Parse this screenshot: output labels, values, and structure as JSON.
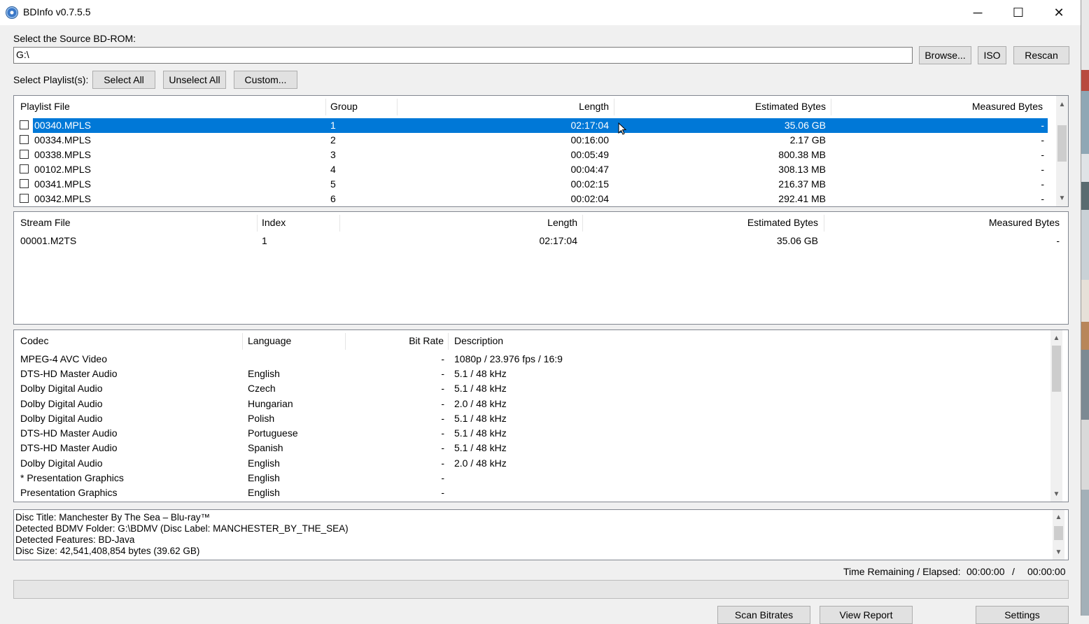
{
  "window": {
    "title": "BDInfo v0.7.5.5",
    "controls": {
      "minimize": "─",
      "maximize": "☐",
      "close": "✕"
    }
  },
  "source": {
    "label": "Select the Source BD-ROM:",
    "path": "G:\\",
    "buttons": {
      "browse": "Browse...",
      "iso": "ISO",
      "rescan": "Rescan"
    }
  },
  "playlist_select": {
    "label": "Select Playlist(s):",
    "buttons": {
      "select_all": "Select All",
      "unselect_all": "Unselect All",
      "custom": "Custom..."
    }
  },
  "playlists": {
    "headers": {
      "file": "Playlist File",
      "group": "Group",
      "length": "Length",
      "estimated": "Estimated Bytes",
      "measured": "Measured Bytes"
    },
    "rows": [
      {
        "file": "00340.MPLS",
        "group": "1",
        "length": "02:17:04",
        "estimated": "35.06 GB",
        "measured": "-",
        "selected": true
      },
      {
        "file": "00334.MPLS",
        "group": "2",
        "length": "00:16:00",
        "estimated": "2.17 GB",
        "measured": "-"
      },
      {
        "file": "00338.MPLS",
        "group": "3",
        "length": "00:05:49",
        "estimated": "800.38 MB",
        "measured": "-"
      },
      {
        "file": "00102.MPLS",
        "group": "4",
        "length": "00:04:47",
        "estimated": "308.13 MB",
        "measured": "-"
      },
      {
        "file": "00341.MPLS",
        "group": "5",
        "length": "00:02:15",
        "estimated": "216.37 MB",
        "measured": "-"
      },
      {
        "file": "00342.MPLS",
        "group": "6",
        "length": "00:02:04",
        "estimated": "292.41 MB",
        "measured": "-"
      }
    ]
  },
  "streams": {
    "headers": {
      "file": "Stream File",
      "index": "Index",
      "length": "Length",
      "estimated": "Estimated Bytes",
      "measured": "Measured Bytes"
    },
    "rows": [
      {
        "file": "00001.M2TS",
        "index": "1",
        "length": "02:17:04",
        "estimated": "35.06 GB",
        "measured": "-"
      }
    ]
  },
  "codecs": {
    "headers": {
      "codec": "Codec",
      "language": "Language",
      "bitrate": "Bit Rate",
      "description": "Description"
    },
    "rows": [
      {
        "codec": "MPEG-4 AVC Video",
        "language": "",
        "bitrate": "-",
        "description": "1080p / 23.976 fps / 16:9"
      },
      {
        "codec": "DTS-HD Master Audio",
        "language": "English",
        "bitrate": "-",
        "description": "5.1 / 48 kHz"
      },
      {
        "codec": "Dolby Digital Audio",
        "language": "Czech",
        "bitrate": "-",
        "description": "5.1 / 48 kHz"
      },
      {
        "codec": "Dolby Digital Audio",
        "language": "Hungarian",
        "bitrate": "-",
        "description": "2.0 / 48 kHz"
      },
      {
        "codec": "Dolby Digital Audio",
        "language": "Polish",
        "bitrate": "-",
        "description": "5.1 / 48 kHz"
      },
      {
        "codec": "DTS-HD Master Audio",
        "language": "Portuguese",
        "bitrate": "-",
        "description": "5.1 / 48 kHz"
      },
      {
        "codec": "DTS-HD Master Audio",
        "language": "Spanish",
        "bitrate": "-",
        "description": "5.1 / 48 kHz"
      },
      {
        "codec": "Dolby Digital Audio",
        "language": "English",
        "bitrate": "-",
        "description": "2.0 / 48 kHz"
      },
      {
        "codec": "* Presentation Graphics",
        "language": "English",
        "bitrate": "-",
        "description": ""
      },
      {
        "codec": "Presentation Graphics",
        "language": "English",
        "bitrate": "-",
        "description": ""
      }
    ]
  },
  "disc_info": {
    "lines": [
      "Disc Title: Manchester By The Sea – Blu-ray™",
      "Detected BDMV Folder: G:\\BDMV (Disc Label: MANCHESTER_BY_THE_SEA)",
      "Detected Features: BD-Java",
      "Disc Size: 42,541,408,854 bytes (39.62 GB)"
    ]
  },
  "time": {
    "label": "Time Remaining / Elapsed:",
    "remaining": "00:00:00",
    "separator": "/",
    "elapsed": "00:00:00"
  },
  "progress": {
    "value": 0
  },
  "bottom_buttons": {
    "scan": "Scan Bitrates",
    "report": "View Report",
    "settings": "Settings"
  },
  "colors": {
    "selection": "#0078d7",
    "window_bg": "#f0f0f0"
  }
}
